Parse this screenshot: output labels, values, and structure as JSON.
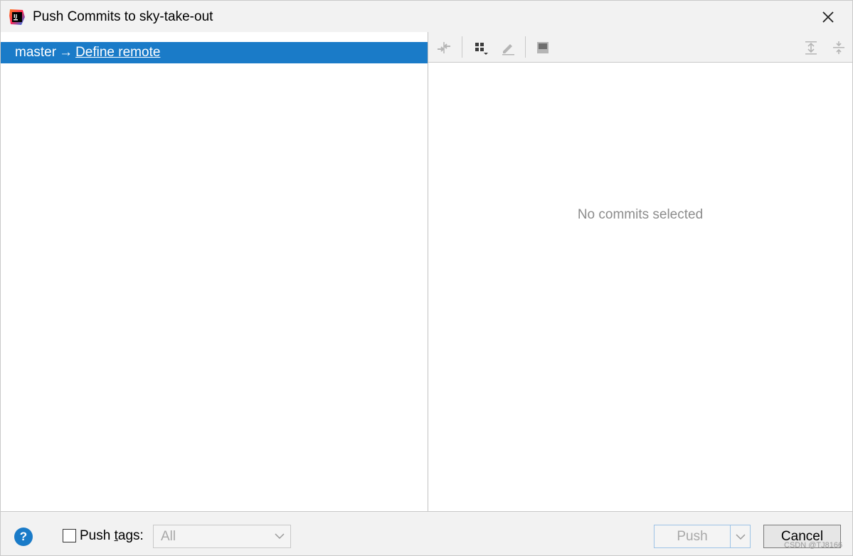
{
  "window": {
    "title": "Push Commits to sky-take-out",
    "app_icon": "intellij-idea-icon",
    "close_icon": "close-icon"
  },
  "left_pane": {
    "repo_row": {
      "branch": "master",
      "arrow": "→",
      "remote_link": "Define remote",
      "selected": true
    }
  },
  "right_pane": {
    "toolbar": {
      "icons": [
        "collapse-arrows-icon",
        "group-by-icon",
        "edit-icon",
        "preview-panel-icon",
        "expand-all-icon",
        "collapse-all-icon"
      ]
    },
    "empty_text": "No commits selected"
  },
  "bottom": {
    "help_label": "?",
    "push_tags_label_pre": "Push ",
    "push_tags_label_mnemonic": "t",
    "push_tags_label_post": "ags:",
    "push_tags_checked": false,
    "tags_select_value": "All",
    "push_label": "Push",
    "cancel_label": "Cancel",
    "watermark": "CSDN @TJ8166"
  },
  "colors": {
    "selection": "#1a7bc8",
    "dialog_bg": "#f2f2f2",
    "disabled_text": "#a8a8a8",
    "empty_text": "#8c8c8c"
  }
}
